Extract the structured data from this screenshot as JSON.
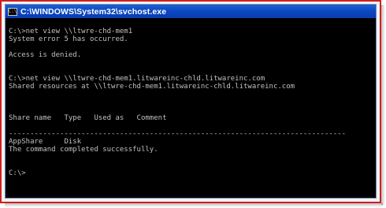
{
  "window": {
    "title": "C:\\WINDOWS\\System32\\svchost.exe",
    "icon": "console-icon"
  },
  "console": {
    "lines": [
      "",
      "C:\\>net view \\\\ltwre-chd-mem1",
      "System error 5 has occurred.",
      "",
      "Access is denied.",
      "",
      "",
      "C:\\>net view \\\\ltwre-chd-mem1.litwareinc-chld.litwareinc.com",
      "Shared resources at \\\\ltwre-chd-mem1.litwareinc-chld.litwareinc.com",
      "",
      "",
      "",
      "Share name   Type   Used as   Comment",
      "",
      "-------------------------------------------------------------------------------",
      "AppShare     Disk",
      "The command completed successfully.",
      "",
      "",
      "C:\\>"
    ]
  }
}
